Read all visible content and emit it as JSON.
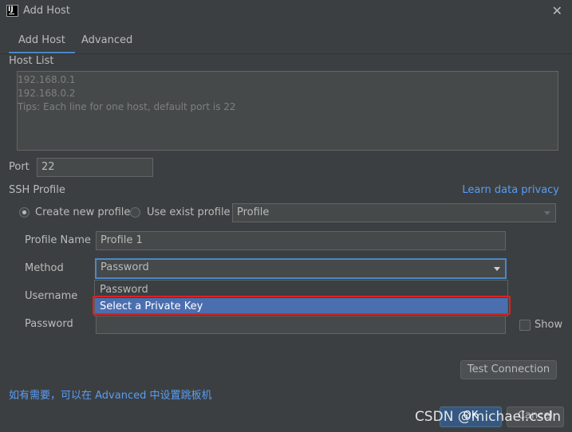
{
  "window": {
    "app_icon_text": "IJ",
    "title": "Add Host",
    "close_glyph": "✕"
  },
  "tabs": [
    {
      "label": "Add Host",
      "active": true
    },
    {
      "label": "Advanced",
      "active": false
    }
  ],
  "host_list": {
    "label": "Host List",
    "placeholder_lines": [
      "192.168.0.1",
      "192.168.0.2",
      "Tips: Each line for one host, default port is 22"
    ]
  },
  "port": {
    "label": "Port",
    "value": "22"
  },
  "ssh_profile": {
    "label": "SSH Profile",
    "privacy_link": "Learn data privacy",
    "create_label": "Create new profile",
    "use_label": "Use exist profile",
    "profile_select_value": "Profile"
  },
  "form": {
    "profile_name_label": "Profile Name",
    "profile_name_value": "Profile 1",
    "method_label": "Method",
    "method_value": "Password",
    "method_options": [
      "Password",
      "Select a Private Key"
    ],
    "highlighted_option": "Select a Private Key",
    "username_label": "Username",
    "password_label": "Password",
    "show_label": "Show"
  },
  "buttons": {
    "test_connection": "Test Connection",
    "ok": "OK",
    "cancel": "Cancel"
  },
  "hint": "如有需要，可以在 Advanced 中设置跳板机",
  "watermark": "CSDN @michael.csdn",
  "colors": {
    "background": "#3c3f41",
    "accent": "#4a88c7",
    "link": "#589df6",
    "selection": "#4b6eaf",
    "highlight_border": "#e02020"
  }
}
